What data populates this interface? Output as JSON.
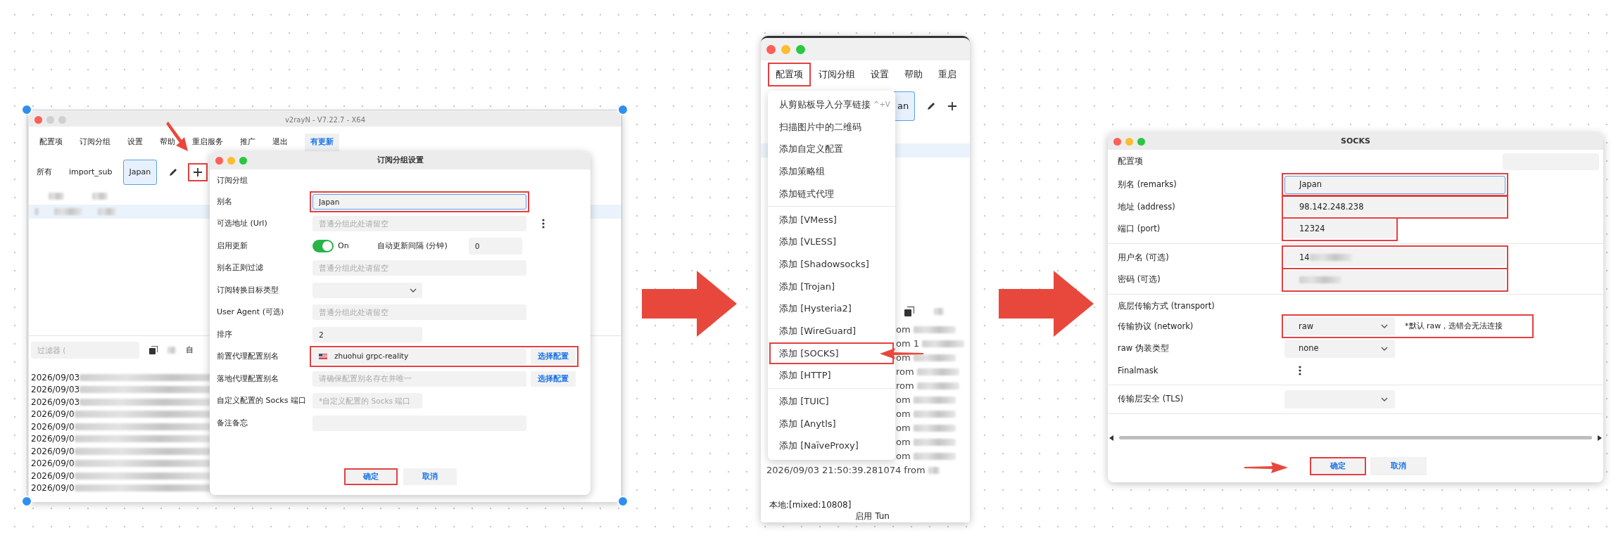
{
  "left_panel": {
    "main_window": {
      "title": "v2rayN - V7.22.7 - X64",
      "menu": [
        {
          "label": "配置项",
          "kind": "plain"
        },
        {
          "label": "订阅分组",
          "kind": "plain"
        },
        {
          "label": "设置",
          "kind": "plain"
        },
        {
          "label": "帮助",
          "kind": "plain"
        },
        {
          "label": "重启服务",
          "kind": "plain"
        },
        {
          "label": "推广",
          "kind": "plain"
        },
        {
          "label": "退出",
          "kind": "plain"
        },
        {
          "label": "有更新",
          "kind": "update"
        }
      ],
      "group_tabs": [
        {
          "label": "所有",
          "selected": false
        },
        {
          "label": "import_sub",
          "selected": false
        },
        {
          "label": "Japan",
          "selected": true
        }
      ],
      "add_group_highlighted": true,
      "filter": {
        "placeholder": "过滤器 ("
      },
      "toolbar_text": "自",
      "log_lines": [
        "2026/09/03",
        "2026/09/03",
        "2026/09/03",
        "2026/09/0",
        "2026/09/0",
        "2026/09/0",
        "2026/09/0",
        "2026/09/0",
        "2026/09/0",
        "2026/09/0"
      ]
    },
    "dialog": {
      "title": "订阅分组设置",
      "section": "订阅分组",
      "fields": [
        {
          "kind": "text",
          "label": "别名",
          "value": "Japan",
          "focused": true,
          "highlighted": true
        },
        {
          "kind": "text",
          "label": "可选地址 (Url)",
          "placeholder": "普通分组此处请留空",
          "focused": false,
          "highlighted": false,
          "more": true
        },
        {
          "kind": "toggle",
          "label": "启用更新",
          "on": true,
          "state_text": "On",
          "extra_label": "自动更新间隔 (分钟)",
          "extra_value": "0",
          "highlighted": false
        },
        {
          "kind": "text",
          "label": "别名正则过滤",
          "placeholder": "普通分组此处请留空",
          "focused": false,
          "highlighted": false
        },
        {
          "kind": "select",
          "label": "订阅转换目标类型",
          "highlighted": false
        },
        {
          "kind": "text",
          "label": "User Agent (可选)",
          "placeholder": "普通分组此处请留空",
          "focused": false,
          "highlighted": false
        },
        {
          "kind": "short_text",
          "label": "排序",
          "value": "2",
          "focused": false,
          "highlighted": false
        },
        {
          "kind": "chooser",
          "label": "前置代理配置别名",
          "value": "zhuohui grpc-reality",
          "flag": true,
          "button": "选择配置",
          "highlighted": true
        },
        {
          "kind": "chooser",
          "label": "落地代理配置别名",
          "placeholder": "请确保配置别名存在并唯一",
          "button": "选择配置",
          "highlighted": false
        },
        {
          "kind": "short_text",
          "label": "自定义配置的 Socks 端口",
          "placeholder": "*自定义配置的 Socks 端口",
          "focused": false,
          "highlighted": false
        },
        {
          "kind": "text",
          "label": "备注备忘",
          "focused": false,
          "highlighted": false
        }
      ],
      "buttons": [
        {
          "label": "确定",
          "highlighted": true
        },
        {
          "label": "取消",
          "highlighted": false
        }
      ]
    }
  },
  "middle_panel": {
    "menu": [
      {
        "label": "配置项",
        "highlighted": true
      },
      {
        "label": "订阅分组",
        "highlighted": false
      },
      {
        "label": "设置",
        "highlighted": false
      },
      {
        "label": "帮助",
        "highlighted": false
      },
      {
        "label": "重启",
        "highlighted": false
      }
    ],
    "tab_fragment": "an",
    "dropdown": [
      {
        "kind": "item",
        "label": "从剪贴板导入分享链接",
        "shortcut": "^+V",
        "highlighted": false
      },
      {
        "kind": "item",
        "label": "扫描图片中的二维码",
        "highlighted": false
      },
      {
        "kind": "item",
        "label": "添加自定义配置",
        "highlighted": false
      },
      {
        "kind": "item",
        "label": "添加策略组",
        "highlighted": false
      },
      {
        "kind": "item",
        "label": "添加链式代理",
        "highlighted": false
      },
      {
        "kind": "separator"
      },
      {
        "kind": "item",
        "label": "添加 [VMess]",
        "highlighted": false
      },
      {
        "kind": "item",
        "label": "添加 [VLESS]",
        "highlighted": false
      },
      {
        "kind": "item",
        "label": "添加 [Shadowsocks]",
        "highlighted": false
      },
      {
        "kind": "item",
        "label": "添加 [Trojan]",
        "highlighted": false
      },
      {
        "kind": "item",
        "label": "添加 [Hysteria2]",
        "highlighted": false
      },
      {
        "kind": "item",
        "label": "添加 [WireGuard]",
        "highlighted": false
      },
      {
        "kind": "item",
        "label": "添加 [SOCKS]",
        "highlighted": true
      },
      {
        "kind": "item",
        "label": "添加 [HTTP]",
        "highlighted": false
      },
      {
        "kind": "separator"
      },
      {
        "kind": "item",
        "label": "添加 [TUIC]",
        "highlighted": false
      },
      {
        "kind": "item",
        "label": "添加 [Anytls]",
        "highlighted": false
      },
      {
        "kind": "item",
        "label": "添加 [NaïveProxy]",
        "highlighted": false
      }
    ],
    "log_fragments": [
      "om",
      "om 1",
      "om",
      "rom",
      "rom",
      "om",
      "om",
      "om",
      "om",
      "om"
    ],
    "log_line": "2026/09/03 21:50:39.281074 from",
    "status": [
      "本地:[mixed:10808]",
      "启用 Tun"
    ]
  },
  "right_panel": {
    "title": "SOCKS",
    "section": "配置项",
    "rows": [
      {
        "kind": "text",
        "label": "别名 (remarks)",
        "value": "Japan",
        "focused": true,
        "highlighted": true
      },
      {
        "kind": "text",
        "label": "地址 (address)",
        "value": "98.142.248.238",
        "focused": false,
        "highlighted": true
      },
      {
        "kind": "short_text",
        "label": "端口 (port)",
        "value": "12324",
        "focused": false,
        "highlighted": true
      },
      {
        "kind": "separator"
      },
      {
        "kind": "text",
        "label": "用户名 (可选)",
        "value": "14",
        "blurred": true,
        "focused": false,
        "highlighted": true
      },
      {
        "kind": "text",
        "label": "密码 (可选)",
        "blurred": true,
        "focused": false,
        "highlighted": true
      },
      {
        "kind": "separator"
      },
      {
        "kind": "heading",
        "label": "底层传输方式 (transport)"
      },
      {
        "kind": "select",
        "label": "传输协议 (network)",
        "value": "raw",
        "note": "*默认 raw，选错会无法连接",
        "highlighted": true
      },
      {
        "kind": "select",
        "label": "raw 伪装类型",
        "value": "none",
        "highlighted": false
      },
      {
        "kind": "more",
        "label": "Finalmask"
      },
      {
        "kind": "separator"
      },
      {
        "kind": "select",
        "label": "传输层安全 (TLS)",
        "highlighted": false
      },
      {
        "kind": "separator"
      }
    ],
    "buttons": [
      {
        "label": "确定",
        "highlighted": true
      },
      {
        "label": "取消",
        "highlighted": false
      }
    ]
  }
}
